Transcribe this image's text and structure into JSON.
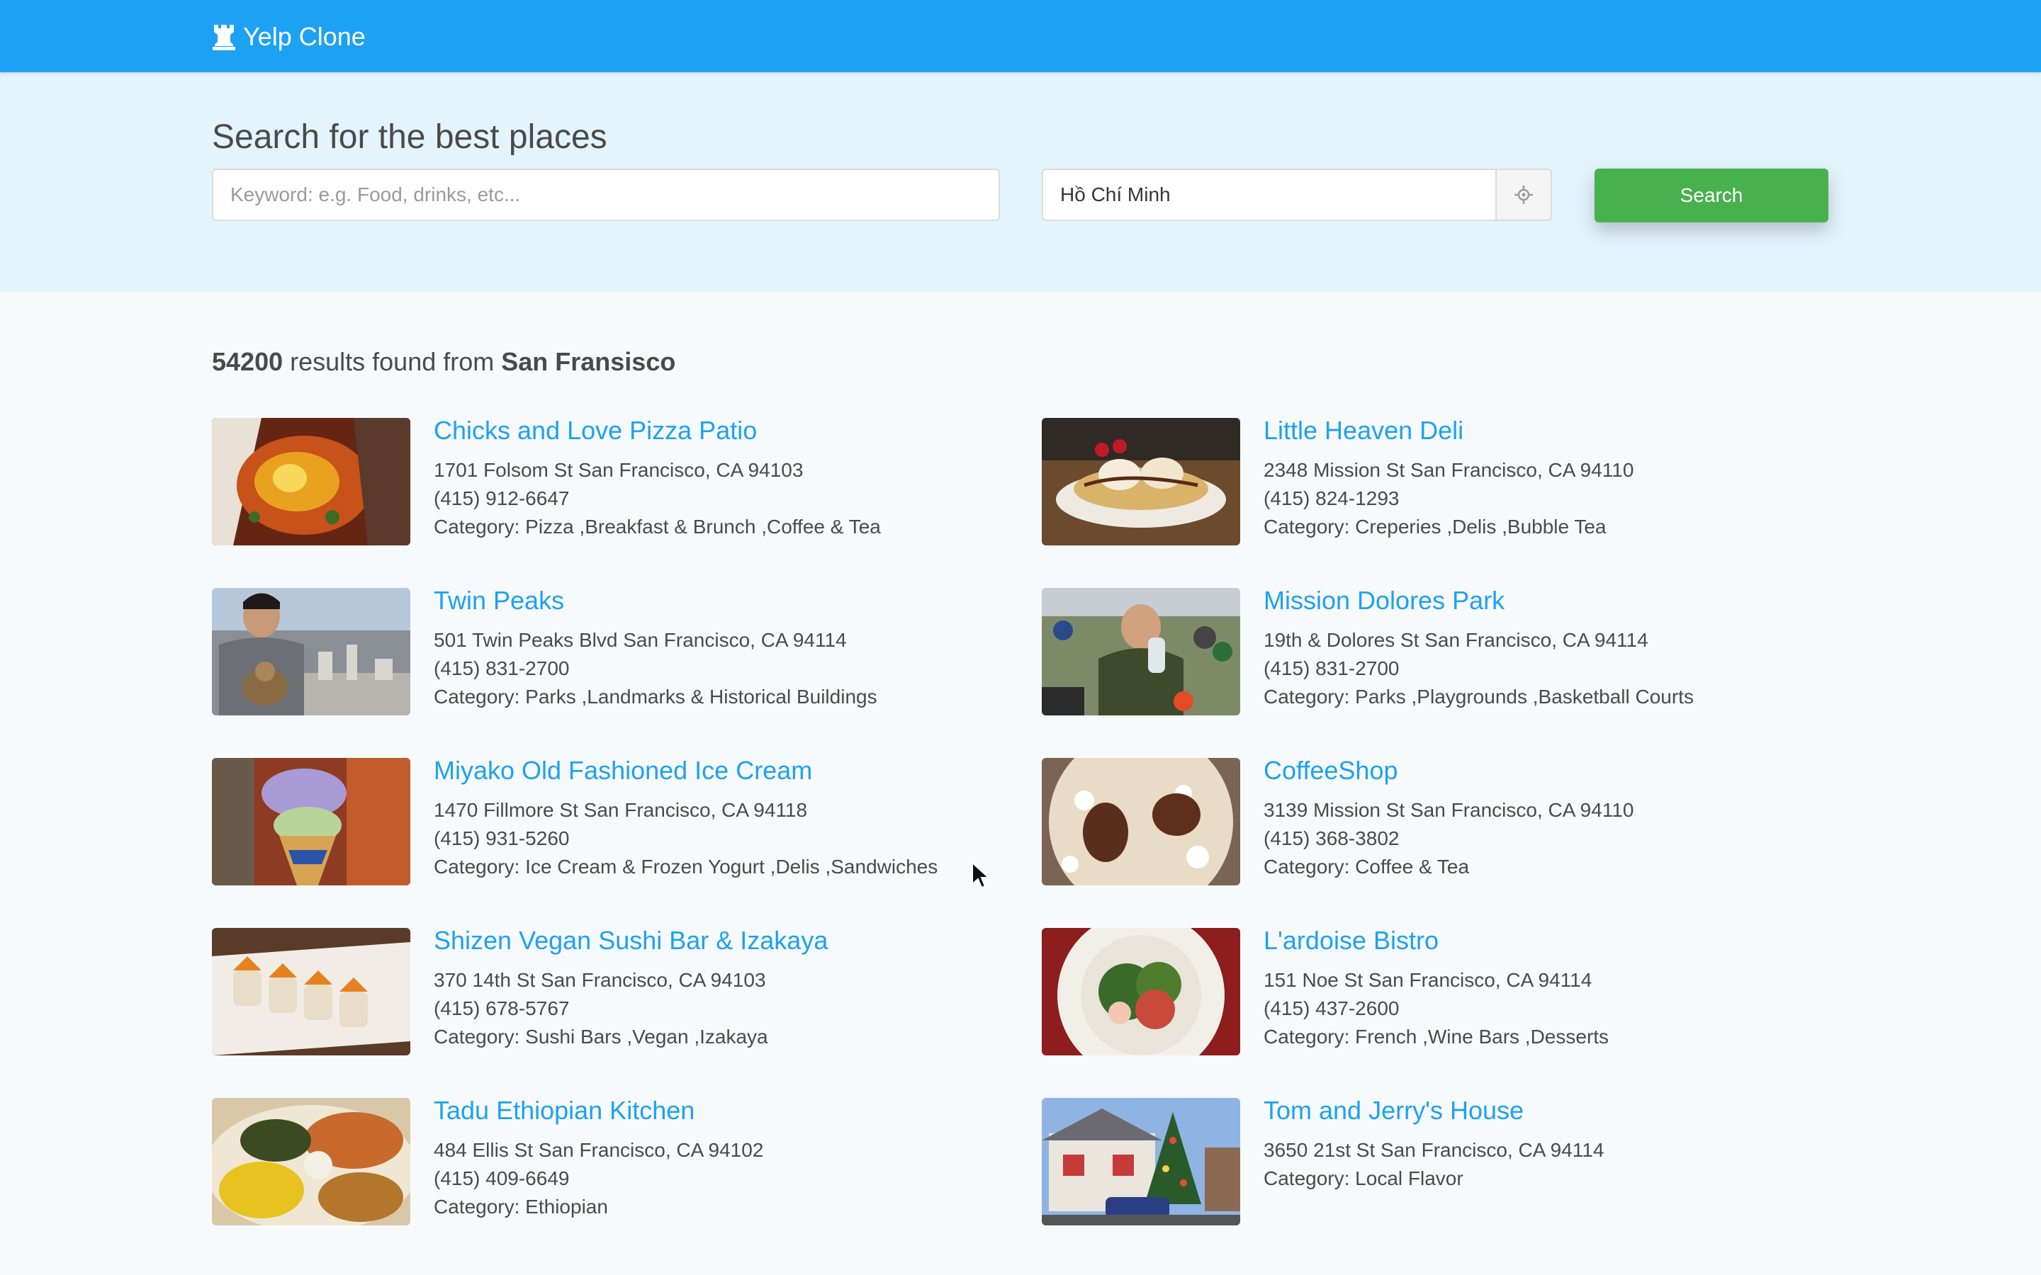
{
  "navbar": {
    "brand": "Yelp Clone",
    "brand_icon": "chess-rook-icon",
    "color": "#1da1f2"
  },
  "hero": {
    "heading": "Search for the best places",
    "keyword_placeholder": "Keyword: e.g. Food, drinks, etc...",
    "keyword_value": "",
    "location_value": "Hồ Chí Minh",
    "locate_icon": "crosshair-icon",
    "search_label": "Search",
    "search_color": "#48b14e"
  },
  "summary": {
    "count": "54200",
    "middle": " results found from ",
    "city": "San Fransisco"
  },
  "results": [
    {
      "name": "Chicks and Love Pizza Patio",
      "address": "1701 Folsom St San Francisco, CA 94103",
      "phone": "(415) 912-6647",
      "category": "Category: Pizza ,Breakfast & Brunch ,Coffee & Tea"
    },
    {
      "name": "Little Heaven Deli",
      "address": "2348 Mission St San Francisco, CA 94110",
      "phone": "(415) 824-1293",
      "category": "Category: Creperies ,Delis ,Bubble Tea"
    },
    {
      "name": "Twin Peaks",
      "address": "501 Twin Peaks Blvd San Francisco, CA 94114",
      "phone": "(415) 831-2700",
      "category": "Category: Parks ,Landmarks & Historical Buildings"
    },
    {
      "name": "Mission Dolores Park",
      "address": "19th & Dolores St San Francisco, CA 94114",
      "phone": "(415) 831-2700",
      "category": "Category: Parks ,Playgrounds ,Basketball Courts"
    },
    {
      "name": "Miyako Old Fashioned Ice Cream",
      "address": "1470 Fillmore St San Francisco, CA 94118",
      "phone": "(415) 931-5260",
      "category": "Category: Ice Cream & Frozen Yogurt ,Delis ,Sandwiches"
    },
    {
      "name": "CoffeeShop",
      "address": "3139 Mission St San Francisco, CA 94110",
      "phone": "(415) 368-3802",
      "category": "Category: Coffee & Tea"
    },
    {
      "name": "Shizen Vegan Sushi Bar & Izakaya",
      "address": "370 14th St San Francisco, CA 94103",
      "phone": "(415) 678-5767",
      "category": "Category: Sushi Bars ,Vegan ,Izakaya"
    },
    {
      "name": "L'ardoise Bistro",
      "address": "151 Noe St San Francisco, CA 94114",
      "phone": "(415) 437-2600",
      "category": "Category: French ,Wine Bars ,Desserts"
    },
    {
      "name": "Tadu Ethiopian Kitchen",
      "address": "484 Ellis St San Francisco, CA 94102",
      "phone": "(415) 409-6649",
      "category": "Category: Ethiopian"
    },
    {
      "name": "Tom and Jerry's House",
      "address": "3650 21st St San Francisco, CA 94114",
      "category": "Category: Local Flavor"
    }
  ]
}
